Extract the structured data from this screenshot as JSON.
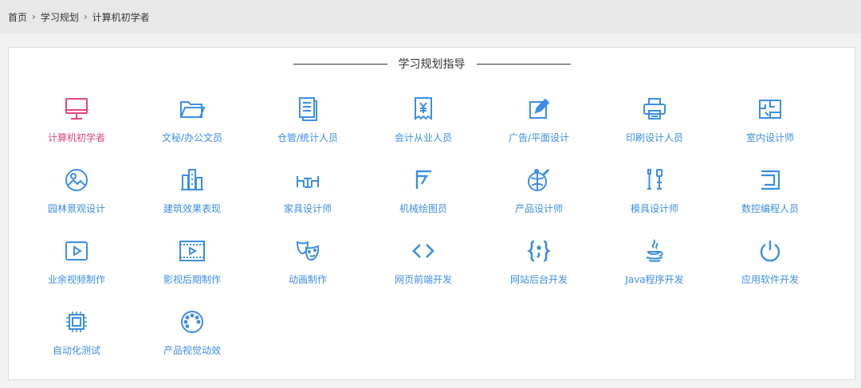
{
  "breadcrumb": {
    "items": [
      "首页",
      "学习规划",
      "计算机初学者"
    ]
  },
  "panel": {
    "title": "学习规划指导"
  },
  "categories": [
    {
      "label": "计算机初学者",
      "icon": "monitor-icon"
    },
    {
      "label": "文秘/办公文员",
      "icon": "folder-icon"
    },
    {
      "label": "仓管/统计人员",
      "icon": "document-icon"
    },
    {
      "label": "会计从业人员",
      "icon": "yuan-doc-icon"
    },
    {
      "label": "广告/平面设计",
      "icon": "edit-icon"
    },
    {
      "label": "印刷设计人员",
      "icon": "printer-icon"
    },
    {
      "label": "室内设计师",
      "icon": "floorplan-icon"
    },
    {
      "label": "园林景观设计",
      "icon": "landscape-icon"
    },
    {
      "label": "建筑效果表现",
      "icon": "building-icon"
    },
    {
      "label": "家具设计师",
      "icon": "furniture-icon"
    },
    {
      "label": "机械绘图员",
      "icon": "drafting-icon"
    },
    {
      "label": "产品设计师",
      "icon": "product-icon"
    },
    {
      "label": "模具设计师",
      "icon": "tools-icon"
    },
    {
      "label": "数控编程人员",
      "icon": "cnc-icon"
    },
    {
      "label": "业余视频制作",
      "icon": "video-icon"
    },
    {
      "label": "影视后期制作",
      "icon": "film-icon"
    },
    {
      "label": "动画制作",
      "icon": "masks-icon"
    },
    {
      "label": "网页前端开发",
      "icon": "code-icon"
    },
    {
      "label": "网站后台开发",
      "icon": "braces-icon"
    },
    {
      "label": "Java程序开发",
      "icon": "java-icon"
    },
    {
      "label": "应用软件开发",
      "icon": "power-icon"
    },
    {
      "label": "自动化测试",
      "icon": "chip-icon"
    },
    {
      "label": "产品视觉动效",
      "icon": "dial-icon"
    }
  ],
  "colors": {
    "accent": "#3b8ee6",
    "active": "#e8447a"
  }
}
